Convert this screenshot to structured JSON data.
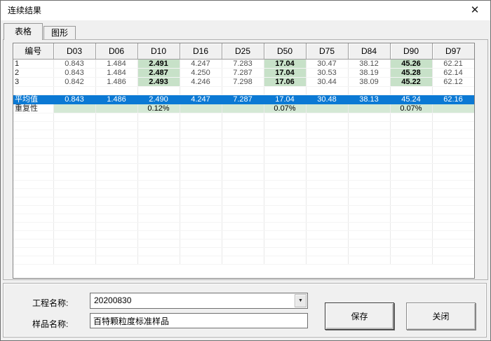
{
  "window": {
    "title": "连续结果",
    "close_glyph": "✕"
  },
  "tabs": [
    {
      "label": "表格",
      "active": true
    },
    {
      "label": "图形",
      "active": false
    }
  ],
  "table": {
    "columns": [
      "编号",
      "D03",
      "D06",
      "D10",
      "D16",
      "D25",
      "D50",
      "D75",
      "D84",
      "D90",
      "D97"
    ],
    "highlight_columns": [
      "D10",
      "D50",
      "D90"
    ],
    "rows": [
      {
        "type": "data",
        "label": "1",
        "values": [
          "0.843",
          "1.484",
          "2.491",
          "4.247",
          "7.283",
          "17.04",
          "30.47",
          "38.12",
          "45.26",
          "62.21"
        ]
      },
      {
        "type": "data",
        "label": "2",
        "values": [
          "0.843",
          "1.484",
          "2.487",
          "4.250",
          "7.287",
          "17.04",
          "30.53",
          "38.19",
          "45.28",
          "62.14"
        ]
      },
      {
        "type": "data",
        "label": "3",
        "values": [
          "0.842",
          "1.486",
          "2.493",
          "4.246",
          "7.298",
          "17.06",
          "30.44",
          "38.09",
          "45.22",
          "62.12"
        ]
      },
      {
        "type": "spacer",
        "label": "",
        "values": [
          "",
          "",
          "",
          "",
          "",
          "",
          "",
          "",
          "",
          ""
        ]
      },
      {
        "type": "average",
        "label": "平均值",
        "values": [
          "0.843",
          "1.486",
          "2.490",
          "4.247",
          "7.287",
          "17.04",
          "30.48",
          "38.13",
          "45.24",
          "62.16"
        ]
      },
      {
        "type": "repeat",
        "label": "重复性",
        "values": [
          "",
          "",
          "0.12%",
          "",
          "",
          "0.07%",
          "",
          "",
          "0.07%",
          ""
        ]
      }
    ],
    "empty_filler_rows": 18
  },
  "form": {
    "project_label": "工程名称:",
    "project_value": "20200830",
    "sample_label": "样品名称:",
    "sample_value": "百特颗粒度标准样品",
    "dropdown_glyph": "▼"
  },
  "buttons": {
    "save": "保存",
    "close": "关闭"
  },
  "colors": {
    "highlight_green": "#c7e1c8",
    "repeat_green": "#d4e8d5",
    "selection_blue": "#0b79d4"
  }
}
